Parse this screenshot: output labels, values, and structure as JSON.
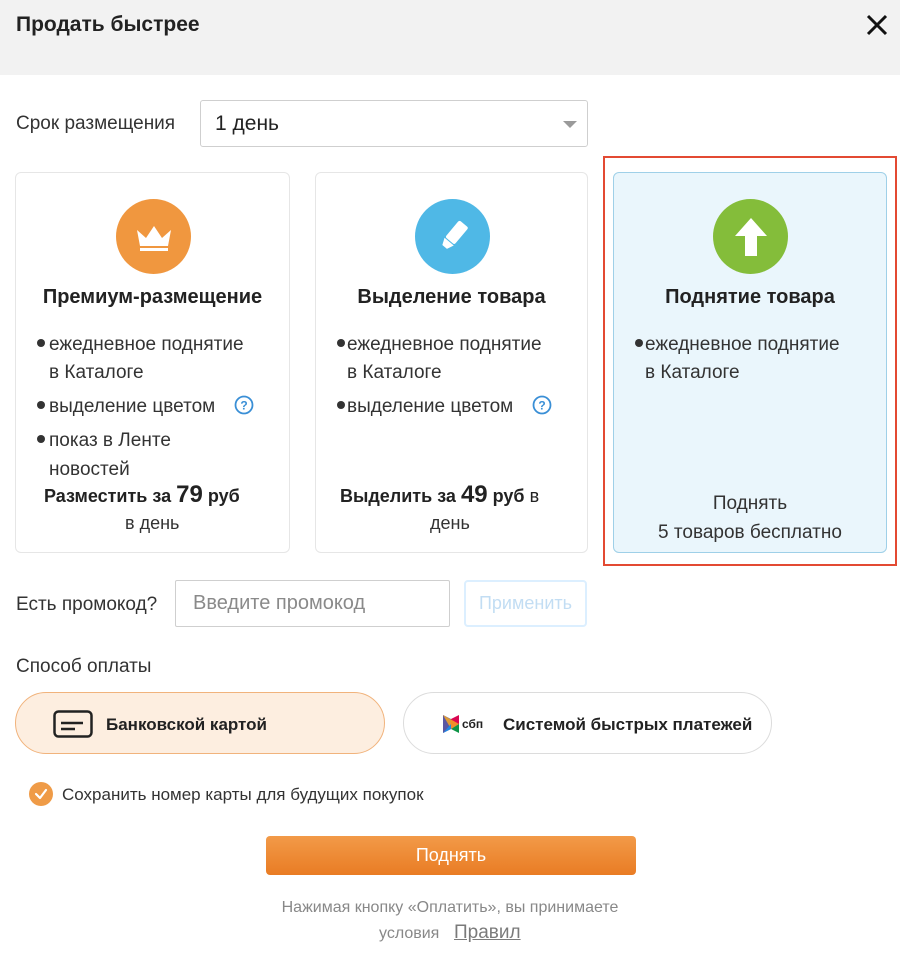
{
  "header": {
    "title": "Продать быстрее"
  },
  "term": {
    "label": "Срок размещения",
    "value": "1 день"
  },
  "cards": [
    {
      "icon": "crown-icon",
      "color": "#f0973f",
      "title": "Премиум-размещение",
      "features": [
        "ежедневное поднятие",
        "в Каталоге",
        "выделение цветом",
        "показ в Ленте",
        "новостей"
      ],
      "price_prefix": "Разместить за",
      "price": "79",
      "price_unit": "руб",
      "per_day": "в день"
    },
    {
      "icon": "marker-icon",
      "color": "#4fb8e6",
      "title": "Выделение товара",
      "features": [
        "ежедневное поднятие",
        "в Каталоге",
        "выделение цветом"
      ],
      "price_prefix": "Выделить за",
      "price": "49",
      "price_unit": "руб",
      "per_day_part1": "в",
      "per_day_part2": "день"
    },
    {
      "icon": "arrow-up-icon",
      "color": "#84bd3a",
      "title": "Поднятие товара",
      "features": [
        "ежедневное поднятие",
        "в Каталоге"
      ],
      "free_line1": "Поднять",
      "free_line2": "5 товаров бесплатно"
    }
  ],
  "promo": {
    "label": "Есть промокод?",
    "placeholder": "Введите промокод",
    "apply": "Применить"
  },
  "payment": {
    "label": "Способ оплаты",
    "options": [
      {
        "label": "Банковской картой",
        "icon": "bank-card-icon"
      },
      {
        "label": "Системой быстрых платежей",
        "icon": "sbp-logo",
        "logo_text": "сбп"
      }
    ],
    "save_card_label": "Сохранить номер карты для будущих покупок"
  },
  "submit": {
    "label": "Поднять"
  },
  "terms": {
    "text": "Нажимая кнопку «Оплатить», вы принимаете",
    "text2": "условия",
    "link": "Правил"
  }
}
